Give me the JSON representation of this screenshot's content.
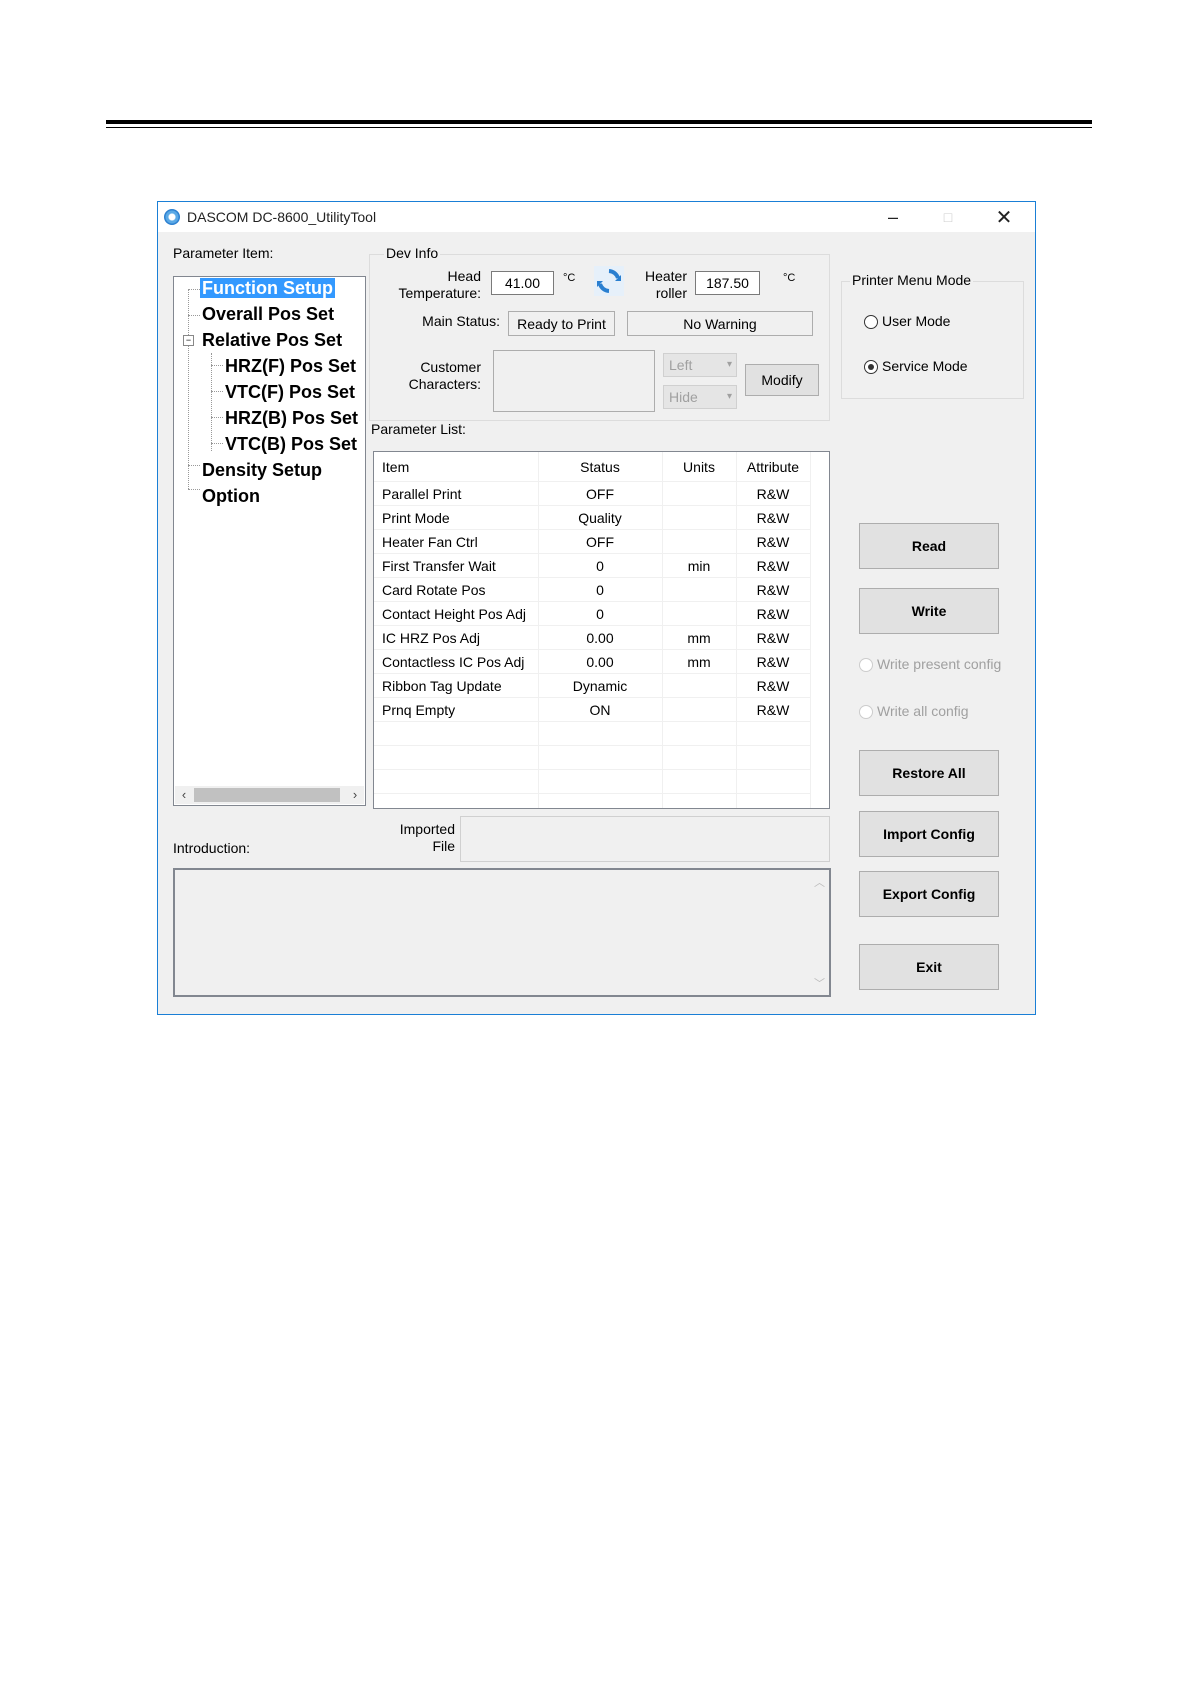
{
  "window": {
    "title": "DASCOM DC-8600_UtilityTool",
    "min": "–",
    "max": "□",
    "close": "✕"
  },
  "labels": {
    "parameter_item": "Parameter Item:",
    "dev_info": "Dev Info",
    "head_temp_1": "Head",
    "head_temp_2": "Temperature:",
    "heater_1": "Heater",
    "heater_2": "roller",
    "celsius": "°C",
    "main_status": "Main Status:",
    "customer_1": "Customer",
    "customer_2": "Characters:",
    "parameter_list": "Parameter List:",
    "introduction": "Introduction:",
    "imported_1": "Imported",
    "imported_2": "File",
    "printer_menu_mode": "Printer Menu Mode"
  },
  "dev_info": {
    "head_temperature": "41.00",
    "heater_roller": "187.50",
    "main_status": "Ready to Print",
    "warning": "No Warning",
    "align_select": "Left",
    "visibility_select": "Hide",
    "modify": "Modify"
  },
  "tree": {
    "items": [
      "Function Setup",
      "Overall Pos Set",
      "Relative Pos Set",
      "HRZ(F) Pos Set",
      "VTC(F) Pos Set",
      "HRZ(B) Pos Set",
      "VTC(B) Pos Set",
      "Density Setup",
      "Option"
    ],
    "selected": "Function Setup"
  },
  "table": {
    "headers": [
      "Item",
      "Status",
      "Units",
      "Attribute"
    ],
    "rows": [
      [
        "Parallel Print",
        "OFF",
        "",
        "R&W"
      ],
      [
        "Print Mode",
        "Quality",
        "",
        "R&W"
      ],
      [
        "Heater Fan Ctrl",
        "OFF",
        "",
        "R&W"
      ],
      [
        "First Transfer Wait",
        "0",
        "min",
        "R&W"
      ],
      [
        "Card Rotate Pos",
        "0",
        "",
        "R&W"
      ],
      [
        "Contact Height Pos Adj",
        "0",
        "",
        "R&W"
      ],
      [
        "IC HRZ Pos Adj",
        "0.00",
        "mm",
        "R&W"
      ],
      [
        "Contactless IC Pos Adj",
        "0.00",
        "mm",
        "R&W"
      ],
      [
        "Ribbon Tag Update",
        "Dynamic",
        "",
        "R&W"
      ],
      [
        "Prnq Empty",
        "ON",
        "",
        "R&W"
      ]
    ]
  },
  "mode": {
    "user": "User Mode",
    "service": "Service Mode",
    "selected": "Service Mode"
  },
  "buttons": {
    "read": "Read",
    "write": "Write",
    "write_present": "Write present config",
    "write_all": "Write all config",
    "restore_all": "Restore All",
    "import_config": "Import Config",
    "export_config": "Export Config",
    "exit": "Exit"
  },
  "colors": {
    "window_border": "#1a7fd6",
    "selection": "#3399ff",
    "refresh_icon": "#2a7fd0"
  }
}
